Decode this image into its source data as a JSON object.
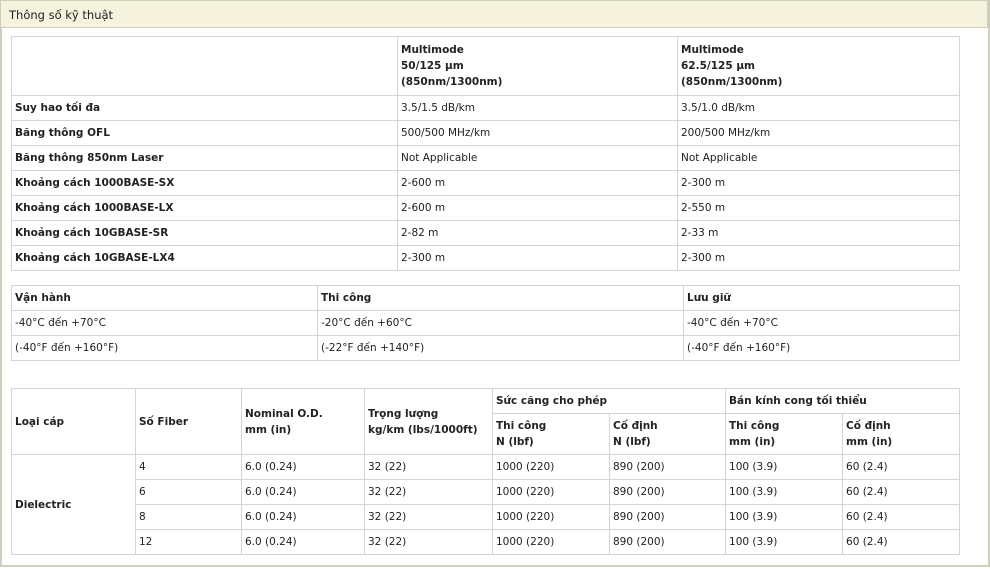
{
  "header": {
    "title": "Thông số kỹ thuật"
  },
  "spec_table": {
    "columns": [
      {
        "line1": "Multimode",
        "line2": "50/125 µm",
        "line3": "(850nm/1300nm)"
      },
      {
        "line1": "Multimode",
        "line2": "62.5/125 µm",
        "line3": "(850nm/1300nm)"
      }
    ],
    "rows": [
      {
        "label": "Suy hao tối đa",
        "v1": "3.5/1.5 dB/km",
        "v2": "3.5/1.0 dB/km"
      },
      {
        "label": "Băng thông OFL",
        "v1": "500/500 MHz/km",
        "v2": "200/500 MHz/km"
      },
      {
        "label": "Băng thông 850nm Laser",
        "v1": "Not Applicable",
        "v2": "Not Applicable"
      },
      {
        "label": "Khoảng cách 1000BASE-SX",
        "v1": "2-600 m",
        "v2": "2-300 m"
      },
      {
        "label": "Khoảng cách 1000BASE-LX",
        "v1": "2-600 m",
        "v2": "2-550 m"
      },
      {
        "label": "Khoảng cách 10GBASE-SR",
        "v1": "2-82 m",
        "v2": "2-33 m"
      },
      {
        "label": "Khoảng cách 10GBASE-LX4",
        "v1": "2-300 m",
        "v2": "2-300 m"
      }
    ]
  },
  "temp_table": {
    "headers": [
      "Vận hành",
      "Thi công",
      "Lưu giữ"
    ],
    "celsius": [
      "-40°C đến +70°C",
      "-20°C đến +60°C",
      "-40°C đến +70°C"
    ],
    "fahrenheit": [
      "(-40°F đến +160°F)",
      "(-22°F đến +140°F)",
      "(-40°F đến +160°F)"
    ]
  },
  "cable_table": {
    "h_type": "Loại cáp",
    "h_fiber": "Số Fiber",
    "h_od1": "Nominal O.D.",
    "h_od2": "mm (in)",
    "h_wt1": "Trọng lượng",
    "h_wt2": "kg/km (lbs/1000ft)",
    "h_tension": "Sức căng cho phép",
    "h_tension_install1": "Thi công",
    "h_tension_install2": "N (lbf)",
    "h_tension_fixed1": "Cố định",
    "h_tension_fixed2": "N (lbf)",
    "h_bend": "Bán kính cong tối thiểu",
    "h_bend_install1": "Thi công",
    "h_bend_install2": "mm (in)",
    "h_bend_fixed1": "Cố định",
    "h_bend_fixed2": "mm (in)",
    "type_value": "Dielectric",
    "rows": [
      {
        "fiber": "4",
        "od": "6.0 (0.24)",
        "wt": "32 (22)",
        "ti": "1000 (220)",
        "tf": "890 (200)",
        "bi": "100 (3.9)",
        "bf": "60 (2.4)"
      },
      {
        "fiber": "6",
        "od": "6.0 (0.24)",
        "wt": "32 (22)",
        "ti": "1000 (220)",
        "tf": "890 (200)",
        "bi": "100 (3.9)",
        "bf": "60 (2.4)"
      },
      {
        "fiber": "8",
        "od": "6.0 (0.24)",
        "wt": "32 (22)",
        "ti": "1000 (220)",
        "tf": "890 (200)",
        "bi": "100 (3.9)",
        "bf": "60 (2.4)"
      },
      {
        "fiber": "12",
        "od": "6.0 (0.24)",
        "wt": "32 (22)",
        "ti": "1000 (220)",
        "tf": "890 (200)",
        "bi": "100 (3.9)",
        "bf": "60 (2.4)"
      }
    ]
  }
}
